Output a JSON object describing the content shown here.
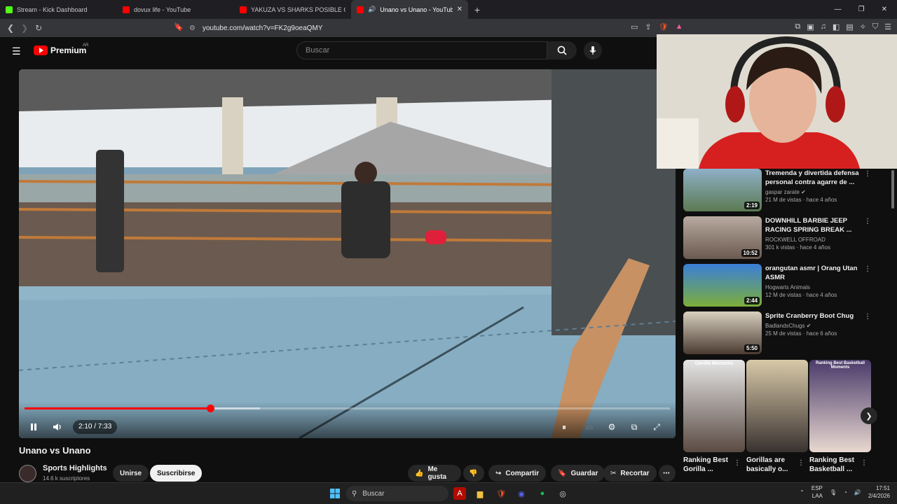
{
  "browser": {
    "tabs": [
      {
        "title": "Stream - Kick Dashboard",
        "favicon_color": "#53fc18",
        "active": false
      },
      {
        "title": "dovux life - YouTube",
        "favicon_color": "#ff0000",
        "active": false
      },
      {
        "title": "YAKUZA VS SHARKS POSIBLE GUERR",
        "favicon_color": "#ff0000",
        "active": false
      },
      {
        "title": "Unano vs Unano - YouTube",
        "favicon_color": "#ff0000",
        "active": true
      }
    ],
    "url": "youtube.com/watch?v=FK2g9oeaQMY"
  },
  "youtube": {
    "logo_text": "Premium",
    "region": "AR",
    "search_placeholder": "Buscar",
    "video": {
      "title": "Unano vs Unano",
      "time_display": "2:10 / 7:33",
      "progress_fraction": 0.288,
      "buffered_fraction": 0.365
    },
    "channel": {
      "name": "Sports Highlights",
      "subscribers": "14.6 k suscriptores",
      "join_label": "Unirse",
      "subscribe_label": "Suscribirse"
    },
    "actions": {
      "like": "Me gusta",
      "share": "Compartir",
      "save": "Guardar",
      "clip": "Recortar"
    },
    "recommendations": [
      {
        "title": "Tremenda y divertida defensa personal contra agarre de ...",
        "channel": "gaspar zarate",
        "verified": true,
        "views": "21 M de vistas · hace 4 años",
        "duration": "2:19"
      },
      {
        "title": "DOWNHILL BARBIE JEEP RACING SPRING BREAK ...",
        "channel": "ROCKWELL OFFROAD",
        "verified": false,
        "views": "301 k vistas · hace 4 años",
        "duration": "10:52"
      },
      {
        "title": "orangutan asmr | Orang Utan ASMR",
        "channel": "Hogwarts Animals",
        "verified": false,
        "views": "12 M de vistas · hace 4 años",
        "duration": "2:44"
      },
      {
        "title": "Sprite Cranberry Boot Chug",
        "channel": "BadlandsChugs",
        "verified": true,
        "views": "25 M de vistas · hace 6 años",
        "duration": "5:50"
      }
    ],
    "shorts": [
      {
        "title": "Ranking Best Gorilla ...",
        "overlay": "Gorilla Moments"
      },
      {
        "title": "Gorillas are basically o...",
        "overlay": ""
      },
      {
        "title": "Ranking Best Basketball ...",
        "overlay": "Ranking Best Basketball Moments"
      }
    ]
  },
  "taskbar": {
    "search_label": "Buscar",
    "lang_top": "ESP",
    "lang_bottom": "LAA",
    "time": "17:51",
    "date": "2/4/2026"
  }
}
